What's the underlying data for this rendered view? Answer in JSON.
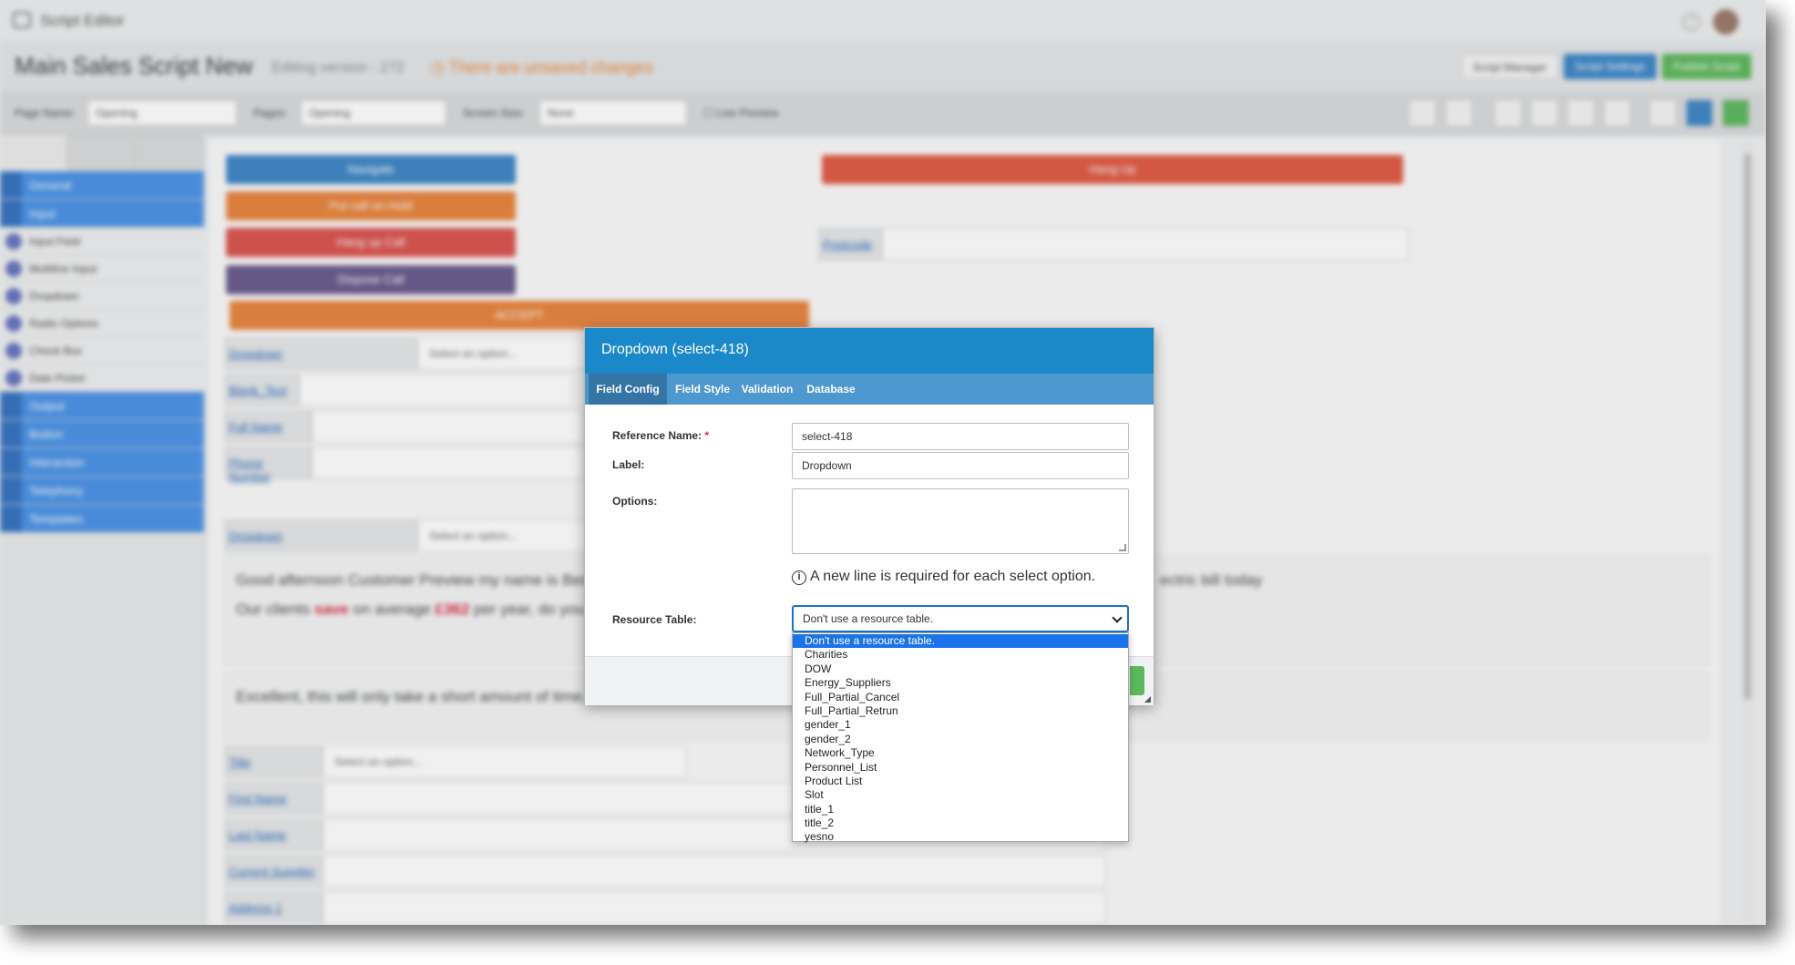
{
  "app": {
    "title": "Script Editor"
  },
  "script": {
    "title": "Main Sales Script New",
    "version": "Editing version - 272",
    "unsaved": "There are unsaved changes",
    "buttons": {
      "manager": "Script Manager",
      "settings": "Script Settings",
      "publish": "Publish Script"
    }
  },
  "toolbar": {
    "page_name_label": "Page Name:",
    "page_name_value": "Opening",
    "pages_label": "Pages:",
    "pages_value": "Opening",
    "screen_size_label": "Screen Size:",
    "screen_size_value": "None",
    "live_preview": "Live Preview"
  },
  "palette": {
    "categories": [
      "General",
      "Input",
      "Output",
      "Button",
      "Interaction",
      "Telephony",
      "Templates"
    ],
    "input_items": [
      "Input Field",
      "Multiline Input",
      "Dropdown",
      "Radio Options",
      "Check Box",
      "Date Picker"
    ]
  },
  "canvas": {
    "buttons": {
      "navigate": "Navigate",
      "hold": "Put call on Hold",
      "hangup_call": "Hang up Call",
      "dispose": "Dispose Call",
      "accept": "ACCEPT",
      "hangup": "Hang Up"
    },
    "fields": {
      "dropdown": "Dropdown",
      "select_placeholder": "Select an option...",
      "blank_text": "Blank_Text",
      "full_name": "Full Name",
      "phone_number": "Phone Number",
      "postcode": "Postcode",
      "title": "Title",
      "first_name": "First Name",
      "last_name": "Last Name",
      "current_supplier": "Current Supplier",
      "address1": "Address 1"
    },
    "text": {
      "greeting": "Good afternoon Customer Preview my name is Ben",
      "greeting_tail": "ectric bill today",
      "clients_a": "Our clients",
      "save": "save",
      "clients_b": "on average",
      "amount": "£362",
      "clients_c": "per year, do you w",
      "excellent": "Excellent, this will only take a short amount of time, s"
    }
  },
  "modal": {
    "title": "Dropdown (select-418)",
    "tabs": [
      "Field Config",
      "Field Style",
      "Validation",
      "Database"
    ],
    "reference_name_label": "Reference Name:",
    "required_mark": "*",
    "reference_name_value": "select-418",
    "label_label": "Label:",
    "label_value": "Dropdown",
    "options_label": "Options:",
    "hint": "A new line is required for each select option.",
    "resource_table_label": "Resource Table:",
    "resource_table_value": "Don't use a resource table.",
    "resource_options": [
      "Don't use a resource table.",
      "Charities",
      "DOW",
      "Energy_Suppliers",
      "Full_Partial_Cancel",
      "Full_Partial_Retrun",
      "gender_1",
      "gender_2",
      "Network_Type",
      "Personnel_List",
      "Product List",
      "Slot",
      "title_1",
      "title_2",
      "yesno"
    ]
  },
  "colors": {
    "modal_header": "#1a88c9",
    "modal_tabs": "#4d98cf",
    "palette_category": "#4a92e6",
    "select_highlight": "#1a73e8",
    "unsaved": "#e8883a"
  }
}
